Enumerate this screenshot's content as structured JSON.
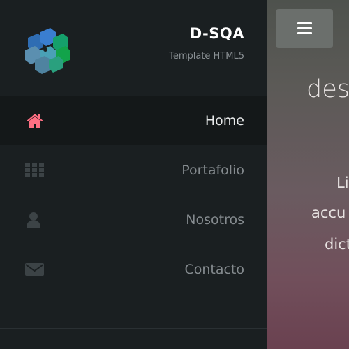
{
  "brand": {
    "title": "D-SQA",
    "subtitle": "Template HTML5",
    "logo_icon": "cube-grid-logo"
  },
  "nav": {
    "items": [
      {
        "label": "Home",
        "icon": "home-icon",
        "active": true
      },
      {
        "label": "Portafolio",
        "icon": "grid-icon",
        "active": false
      },
      {
        "label": "Nosotros",
        "icon": "user-icon",
        "active": false
      },
      {
        "label": "Contacto",
        "icon": "envelope-icon",
        "active": false
      }
    ]
  },
  "main": {
    "menu_button_icon": "hamburger-icon",
    "heading_partial": "desa",
    "paragraph_lines": [
      "Li",
      "accu",
      "dict"
    ]
  },
  "colors": {
    "sidebar_bg": "#1a1f21",
    "active_item_bg": "#141819",
    "active_icon": "#ff6f83",
    "inactive_icon": "#3c4346",
    "inactive_text": "#858b8f",
    "active_text": "#e8eaeb"
  }
}
